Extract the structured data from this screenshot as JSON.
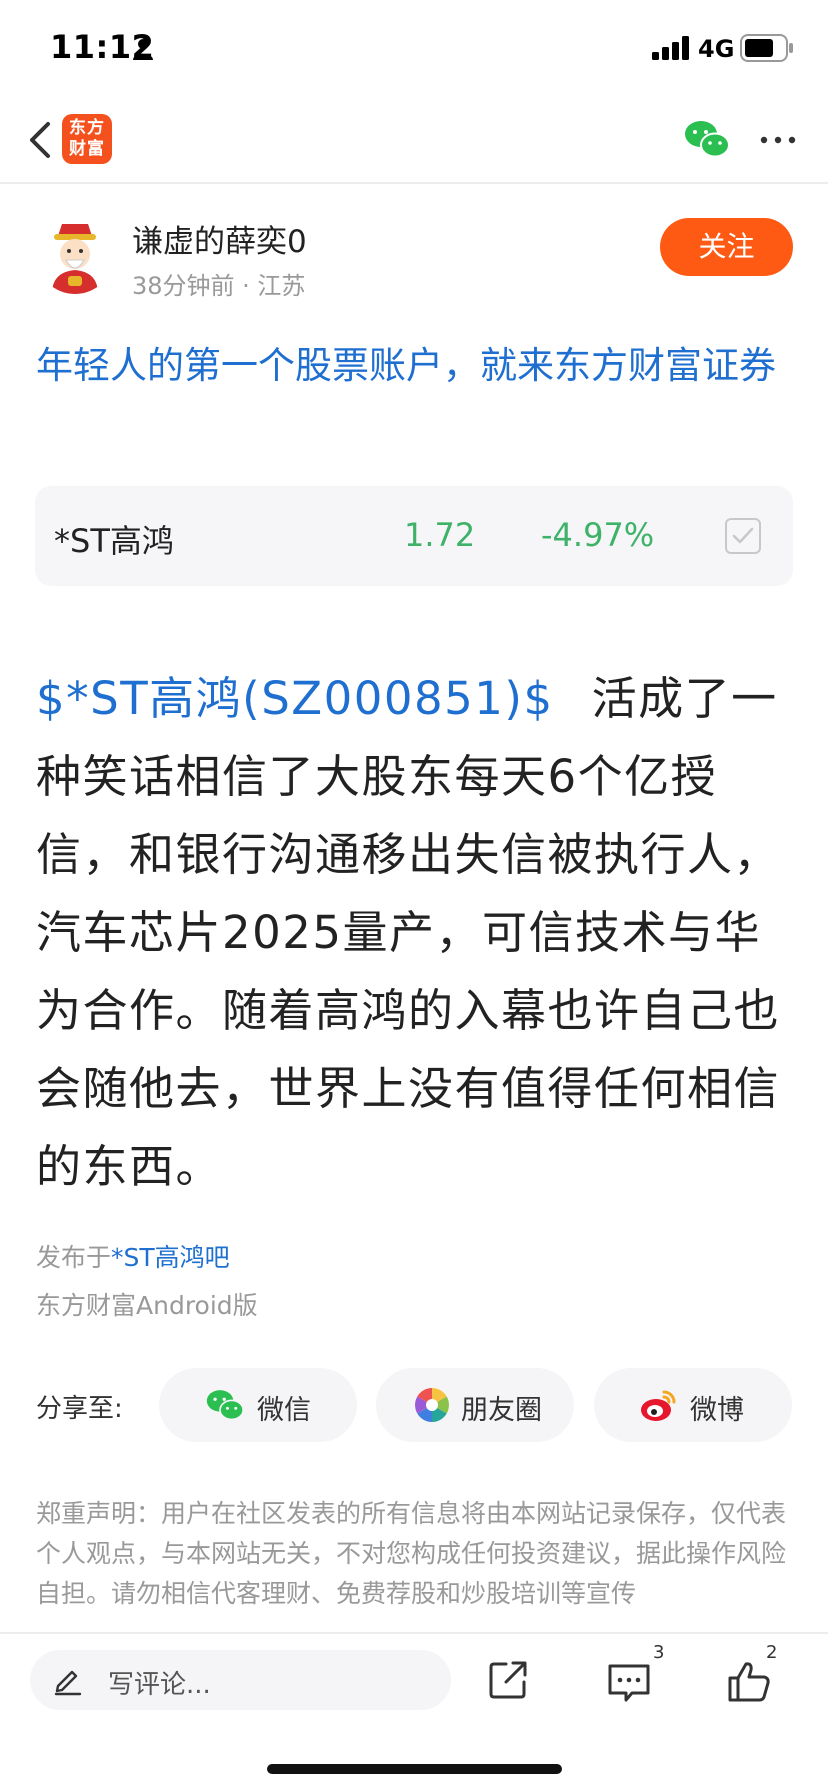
{
  "status_bar": {
    "time": "11:12",
    "network": "4G"
  },
  "nav": {
    "logo_line1": "东方",
    "logo_line2": "财富"
  },
  "author": {
    "name": "谦虚的薛奕0",
    "meta": "38分钟前 · 江苏",
    "follow_label": "关注"
  },
  "ad_headline": "年轻人的第一个股票账户，就来东方财富证券",
  "stock_card": {
    "name": "*ST高鸿",
    "price": "1.72",
    "change": "-4.97%",
    "color": "#3eb268"
  },
  "post": {
    "stock_link": "$*ST高鸿(SZ000851)$",
    "text": "活成了一种笑话相信了大股东每天6个亿授信，和银行沟通移出失信被执行人，汽车芯片2025量产，可信技术与华为合作。随着高鸿的入幕也许自己也会随他去，世界上没有值得任何相信的东西。"
  },
  "source": {
    "prefix": "发布于",
    "bar_link": "*ST高鸿吧",
    "client": "东方财富Android版"
  },
  "share": {
    "label": "分享至:",
    "wechat": "微信",
    "moments": "朋友圈",
    "weibo": "微博"
  },
  "disclaimer": "郑重声明：用户在社区发表的所有信息将由本网站记录保存，仅代表个人观点，与本网站无关，不对您构成任何投资建议，据此操作风险自担。请勿相信代客理财、免费荐股和炒股培训等宣传",
  "bottom_bar": {
    "comment_placeholder": "写评论...",
    "comment_count": "3",
    "like_count": "2"
  },
  "colors": {
    "brand_orange": "#fe5a13",
    "link_blue": "#1f6fd1",
    "down_green": "#3eb268"
  }
}
